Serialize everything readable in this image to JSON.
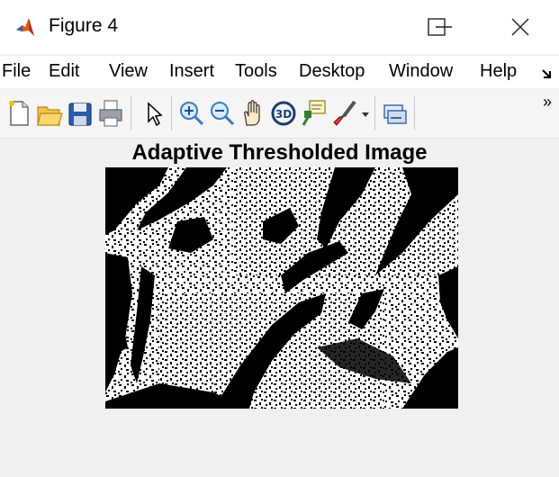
{
  "window": {
    "title": "Figure 4",
    "app_icon": "matlab-icon",
    "controls": [
      "minimize-icon",
      "maximize-icon",
      "close-icon"
    ]
  },
  "menubar": {
    "items": [
      {
        "label": "File"
      },
      {
        "label": "Edit"
      },
      {
        "label": "View"
      },
      {
        "label": "Insert"
      },
      {
        "label": "Tools"
      },
      {
        "label": "Desktop"
      },
      {
        "label": "Window"
      },
      {
        "label": "Help"
      }
    ],
    "overflow_icon": "dock-arrow-icon"
  },
  "toolbar": {
    "buttons": [
      "new-figure-icon",
      "open-file-icon",
      "save-icon",
      "print-icon",
      "select-arrow-icon",
      "zoom-in-icon",
      "zoom-out-icon",
      "pan-icon",
      "rotate-3d-icon",
      "data-cursor-icon",
      "brush-icon",
      "brush-dropdown-icon",
      "link-plot-icon",
      "more-tools-icon"
    ]
  },
  "figure": {
    "title": "Adaptive Thresholded Image",
    "background": "#f0f0f0",
    "image_colors": [
      "#000000",
      "#ffffff"
    ]
  }
}
